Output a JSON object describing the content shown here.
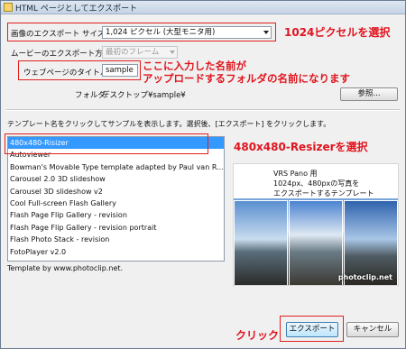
{
  "window": {
    "title": "HTML ページとしてエクスポート"
  },
  "form": {
    "size_label": "画像のエクスポート サイズ:",
    "size_value": "1,024 ピクセル (大型モニタ用)",
    "movie_label": "ムービーのエクスポート方法:",
    "movie_value": "最初のフレーム",
    "title_label": "ウェブページのタイトル:",
    "title_value": "sample",
    "folder_label": "フォルダ:",
    "folder_value": "デスクトップ¥sample¥",
    "browse_label": "参照..."
  },
  "templates": {
    "instruction": "テンプレート名をクリックしてサンプルを表示します。選択後、[エクスポート] をクリックします。",
    "items": [
      "480x480-Risizer",
      "Autoviewer",
      "Bowman's Movable Type template adapted by Paul van R...",
      "Carousel 2.0 3D slideshow",
      "Carousel 3D slideshow v2",
      "Cool Full-screen Flash Gallery",
      "Flash Page Flip Gallery - revision",
      "Flash Page Flip Gallery - revision portrait",
      "Flash Photo Stack - revision",
      "FotoPlayer v2.0"
    ],
    "selected_index": 0,
    "credit": "Template by www.photoclip.net."
  },
  "preview": {
    "line1": "VRS Pano 用",
    "line2": "1024px、480pxの写真を",
    "line3": "エクスポートするテンプレート",
    "watermark": "photoclip.net"
  },
  "buttons": {
    "export": "エクスポート",
    "cancel": "キャンセル"
  },
  "annotations": {
    "size": "1024ピクセルを選択",
    "title_line1": "ここに入力した名前が",
    "title_line2": "アップロードするフォルダの名前になります",
    "template": "480x480-Resizerを選択",
    "click": "クリック"
  },
  "colors": {
    "annotation": "#e0141e",
    "selection": "#3399ff"
  }
}
